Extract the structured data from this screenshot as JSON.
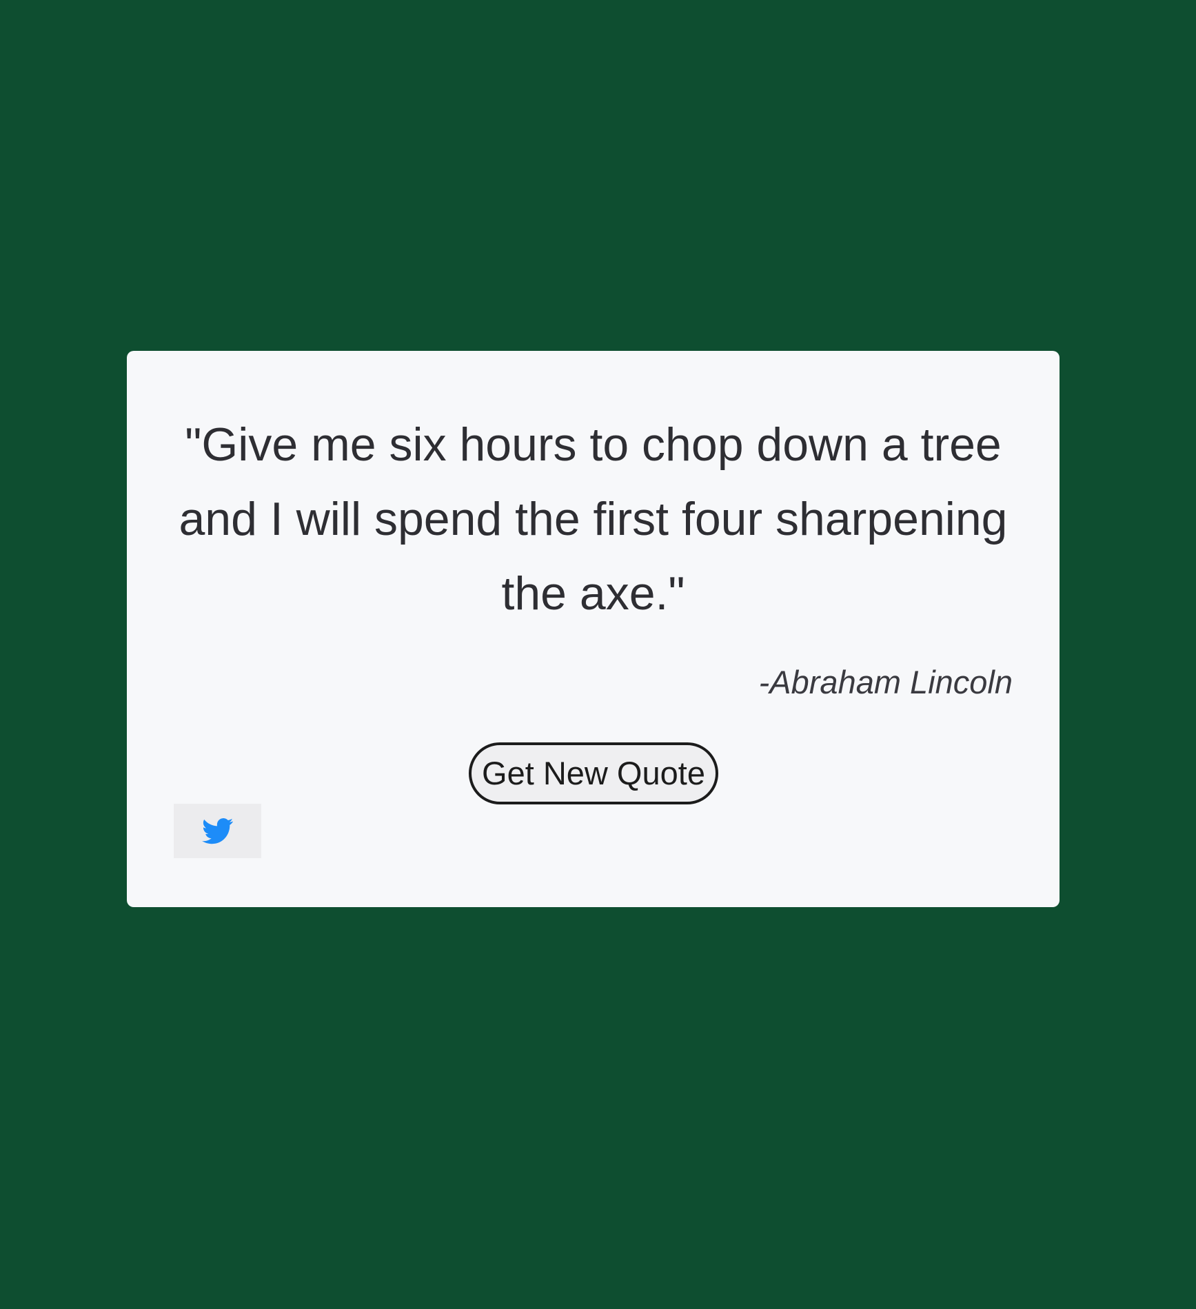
{
  "quote": {
    "text": "\"Give me six hours to chop down a tree and I will spend the first four sharpening the axe.\"",
    "author": "-Abraham Lincoln"
  },
  "actions": {
    "new_quote_label": "Get New Quote",
    "tweet_icon": "twitter-bird-icon"
  },
  "colors": {
    "background": "#0e4e30",
    "card": "#f7f8fa",
    "twitter_blue": "#1d8cf8"
  }
}
